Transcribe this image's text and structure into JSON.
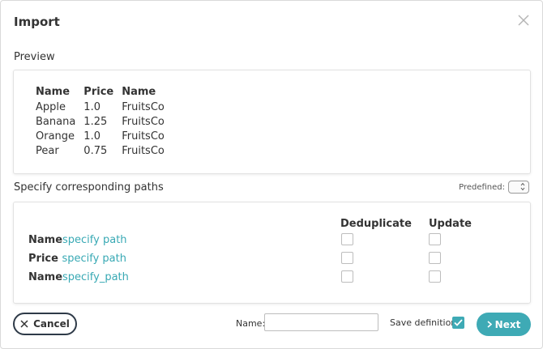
{
  "dialog": {
    "title": "Import"
  },
  "preview": {
    "label": "Preview",
    "columns": [
      "Name",
      "Price",
      "Name"
    ],
    "rows": [
      [
        "Apple",
        "1.0",
        "FruitsCo"
      ],
      [
        "Banana",
        "1.25",
        "FruitsCo"
      ],
      [
        "Orange",
        "1.0",
        "FruitsCo"
      ],
      [
        "Pear",
        "0.75",
        "FruitsCo"
      ]
    ]
  },
  "paths": {
    "label": "Specify corresponding paths",
    "predefined_label": "Predefined:",
    "deduplicate_header": "Deduplicate",
    "update_header": "Update",
    "rows": [
      {
        "label": "Name",
        "link": "specify path"
      },
      {
        "label": "Price ",
        "link": "specify path"
      },
      {
        "label": "Name",
        "link": "specify_path"
      }
    ]
  },
  "footer": {
    "cancel_label": "Cancel",
    "name_label": "Name:",
    "name_value": "",
    "save_label": "Save definition:",
    "save_checked": true,
    "next_label": "Next"
  },
  "icons": {
    "close": "close-icon",
    "cancel": "x-icon",
    "next": "chevron-right-icon",
    "check": "check-icon",
    "select": "select-arrows-icon"
  },
  "colors": {
    "accent": "#3eaab5",
    "link": "#38a9b4",
    "cancel_border": "#2e3a48"
  }
}
